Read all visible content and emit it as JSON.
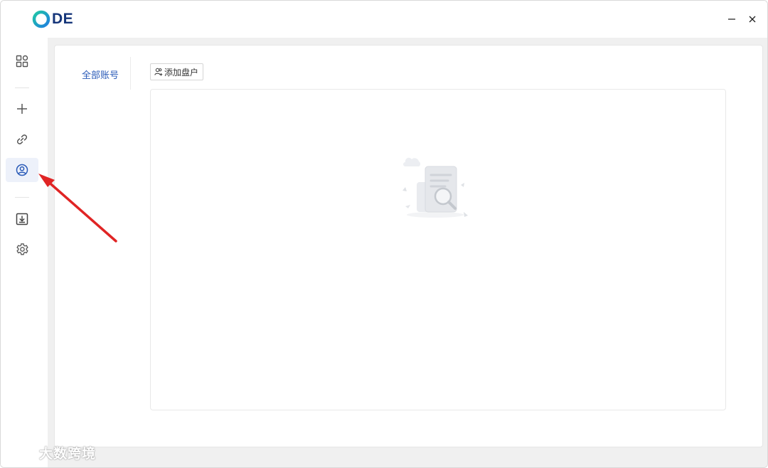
{
  "app": {
    "logo_text": "DE",
    "brand_colors": {
      "ring_start": "#1fc7a6",
      "ring_end": "#1f7fe0",
      "text": "#16367a"
    }
  },
  "window_controls": {
    "minimize_icon": "minimize-icon",
    "close_icon": "close-icon"
  },
  "sidebar": {
    "items": [
      {
        "name": "dashboard",
        "icon": "grid-icon",
        "active": false
      },
      {
        "name": "add",
        "icon": "plus-icon",
        "active": false
      },
      {
        "name": "link",
        "icon": "link-icon",
        "active": false
      },
      {
        "name": "accounts",
        "icon": "user-circle-icon",
        "active": true
      },
      {
        "name": "download",
        "icon": "download-icon",
        "active": false
      },
      {
        "name": "settings",
        "icon": "gear-icon",
        "active": false
      }
    ]
  },
  "main": {
    "tab_all_accounts": "全部账号",
    "add_button_label": "添加盘户",
    "empty_state_icon": "empty-search-document-icon"
  },
  "annotation": {
    "arrow_color": "#e02424"
  },
  "watermark": {
    "text": "大数跨境"
  }
}
